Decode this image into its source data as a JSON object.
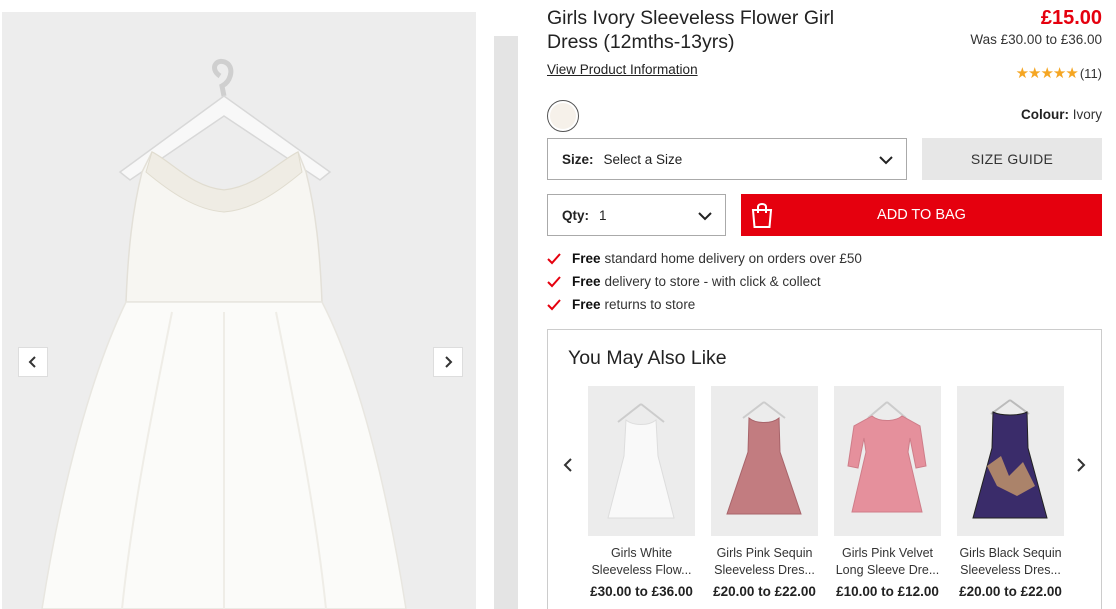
{
  "product": {
    "title": "Girls Ivory Sleeveless Flower Girl Dress (12mths-13yrs)",
    "price_now": "£15.00",
    "price_was": "Was £30.00 to £36.00",
    "view_info": "View Product Information",
    "rating_stars": "★★★★★",
    "review_count": "(11)",
    "colour_label": "Colour:",
    "colour_value": "Ivory",
    "colour_hex": "#f6f1ea"
  },
  "size": {
    "label": "Size:",
    "value": "Select a Size",
    "guide": "SIZE GUIDE"
  },
  "qty": {
    "label": "Qty:",
    "value": "1"
  },
  "add_to_bag": "ADD TO BAG",
  "usps": [
    {
      "bold": "Free",
      "text": "standard home delivery on orders over £50"
    },
    {
      "bold": "Free",
      "text": "delivery to store - with click & collect"
    },
    {
      "bold": "Free",
      "text": "returns to store"
    }
  ],
  "recommendations": {
    "heading": "You May Also Like",
    "items": [
      {
        "line1": "Girls White",
        "line2": "Sleeveless Flow...",
        "price": "£30.00 to £36.00",
        "color": "#f7f7f7"
      },
      {
        "line1": "Girls Pink Sequin",
        "line2": "Sleeveless Dres...",
        "price": "£20.00 to £22.00",
        "color": "#c27c80"
      },
      {
        "line1": "Girls Pink Velvet",
        "line2": "Long Sleeve Dre...",
        "price": "£10.00 to £12.00",
        "color": "#e5909c"
      },
      {
        "line1": "Girls Black Sequin",
        "line2": "Sleeveless Dres...",
        "price": "£20.00 to £22.00",
        "color": "#3a2c6a"
      }
    ]
  },
  "colors": {
    "accent": "#e5000e",
    "star": "#f5a623"
  }
}
